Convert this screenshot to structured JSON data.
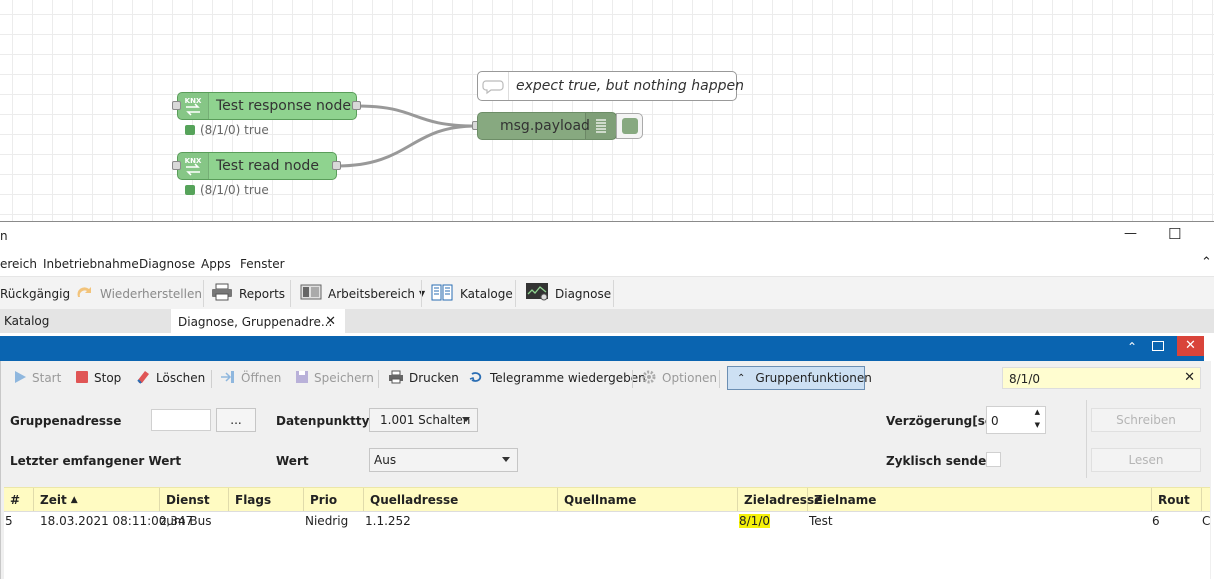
{
  "flow": {
    "nodes": [
      {
        "label": "Test response node",
        "status": "(8/1/0) true",
        "icon": "knx-icon"
      },
      {
        "label": "Test read node",
        "status": "(8/1/0) true",
        "icon": "knx-icon"
      }
    ],
    "comment": "expect true, but nothing happen",
    "debug_label": "msg.payload"
  },
  "window": {
    "title_fragment": "n",
    "minimize_glyph": "—",
    "maximize_glyph": "☐"
  },
  "menu": [
    "ereich",
    "Inbetriebnahme",
    "Diagnose",
    "Apps",
    "Fenster"
  ],
  "ribbon": {
    "undo": "Rückgängig",
    "redo": "Wiederherstellen",
    "reports": "Reports",
    "workspace": "Arbeitsbereich",
    "catalogs": "Kataloge",
    "diagnostics": "Diagnose"
  },
  "tabs": {
    "catalog": "Katalog",
    "active": "Diagnose, Gruppenadre..."
  },
  "toolbar": {
    "start": "Start",
    "stop": "Stop",
    "delete": "Löschen",
    "open": "Öffnen",
    "save": "Speichern",
    "print": "Drucken",
    "replay": "Telegramme wiedergeben",
    "options": "Optionen",
    "group_functions": "Gruppenfunktionen",
    "filter_value": "8/1/0"
  },
  "form": {
    "group_address_label": "Gruppenadresse",
    "browse_label": "...",
    "dpt_label": "Datenpunkttyp",
    "dpt_value": "1.001 Schalten",
    "last_value_label": "Letzter emfangener Wert",
    "value_label": "Wert",
    "value_value": "Aus",
    "delay_label": "Verzögerung[sec]",
    "delay_value": "0",
    "cyclic_label": "Zyklisch senden",
    "write_button": "Schreiben",
    "read_button": "Lesen"
  },
  "table": {
    "headers": {
      "num": "#",
      "time": "Zeit",
      "service": "Dienst",
      "flags": "Flags",
      "prio": "Prio",
      "source": "Quelladresse",
      "source_name": "Quellname",
      "target": "Zieladresse",
      "target_name": "Zielname",
      "rout": "Rout"
    },
    "rows": [
      {
        "num": "5",
        "time": "18.03.2021 08:11:00,347",
        "service": "zum Bus",
        "flags": "",
        "prio": "Niedrig",
        "source": "1.1.252",
        "source_name": "",
        "target": "8/1/0",
        "target_name": "Test",
        "rout": "6",
        "extra": "C"
      }
    ]
  },
  "colors": {
    "node_green": "#8fd38f",
    "debug_green": "#87a980",
    "status_green": "#56a35a",
    "accent_blue": "#0a64b0",
    "close_red": "#d9443a",
    "header_yellow": "#fffbc2",
    "highlight_yellow": "#f5f10a"
  }
}
